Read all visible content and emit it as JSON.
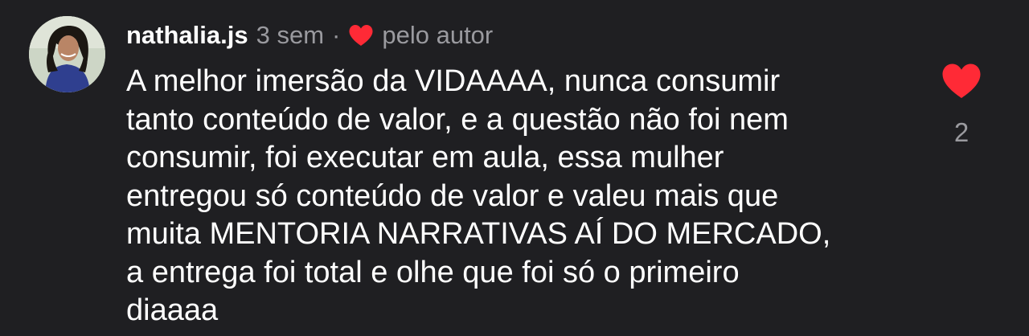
{
  "comment": {
    "username": "nathalia.js",
    "time": "3 sem",
    "separator": "·",
    "liked_by_author": "pelo autor",
    "text_lines": [
      "A melhor imersão da VIDAAAA, nunca consumir",
      "tanto conteúdo de valor, e a questão não foi nem",
      "consumir, foi executar em aula, essa mulher",
      "entregou só conteúdo de valor e valeu mais que",
      "muita MENTORIA NARRATIVAS AÍ DO MERCADO,",
      "a entrega foi total e olhe que foi só o primeiro",
      "diaaaa"
    ],
    "like_count": "2",
    "heart_icon": "heart-icon",
    "heart_color": "#ff2a36"
  },
  "colors": {
    "background": "#1f1f22",
    "text": "#ffffff",
    "muted": "#9a9a9f"
  }
}
